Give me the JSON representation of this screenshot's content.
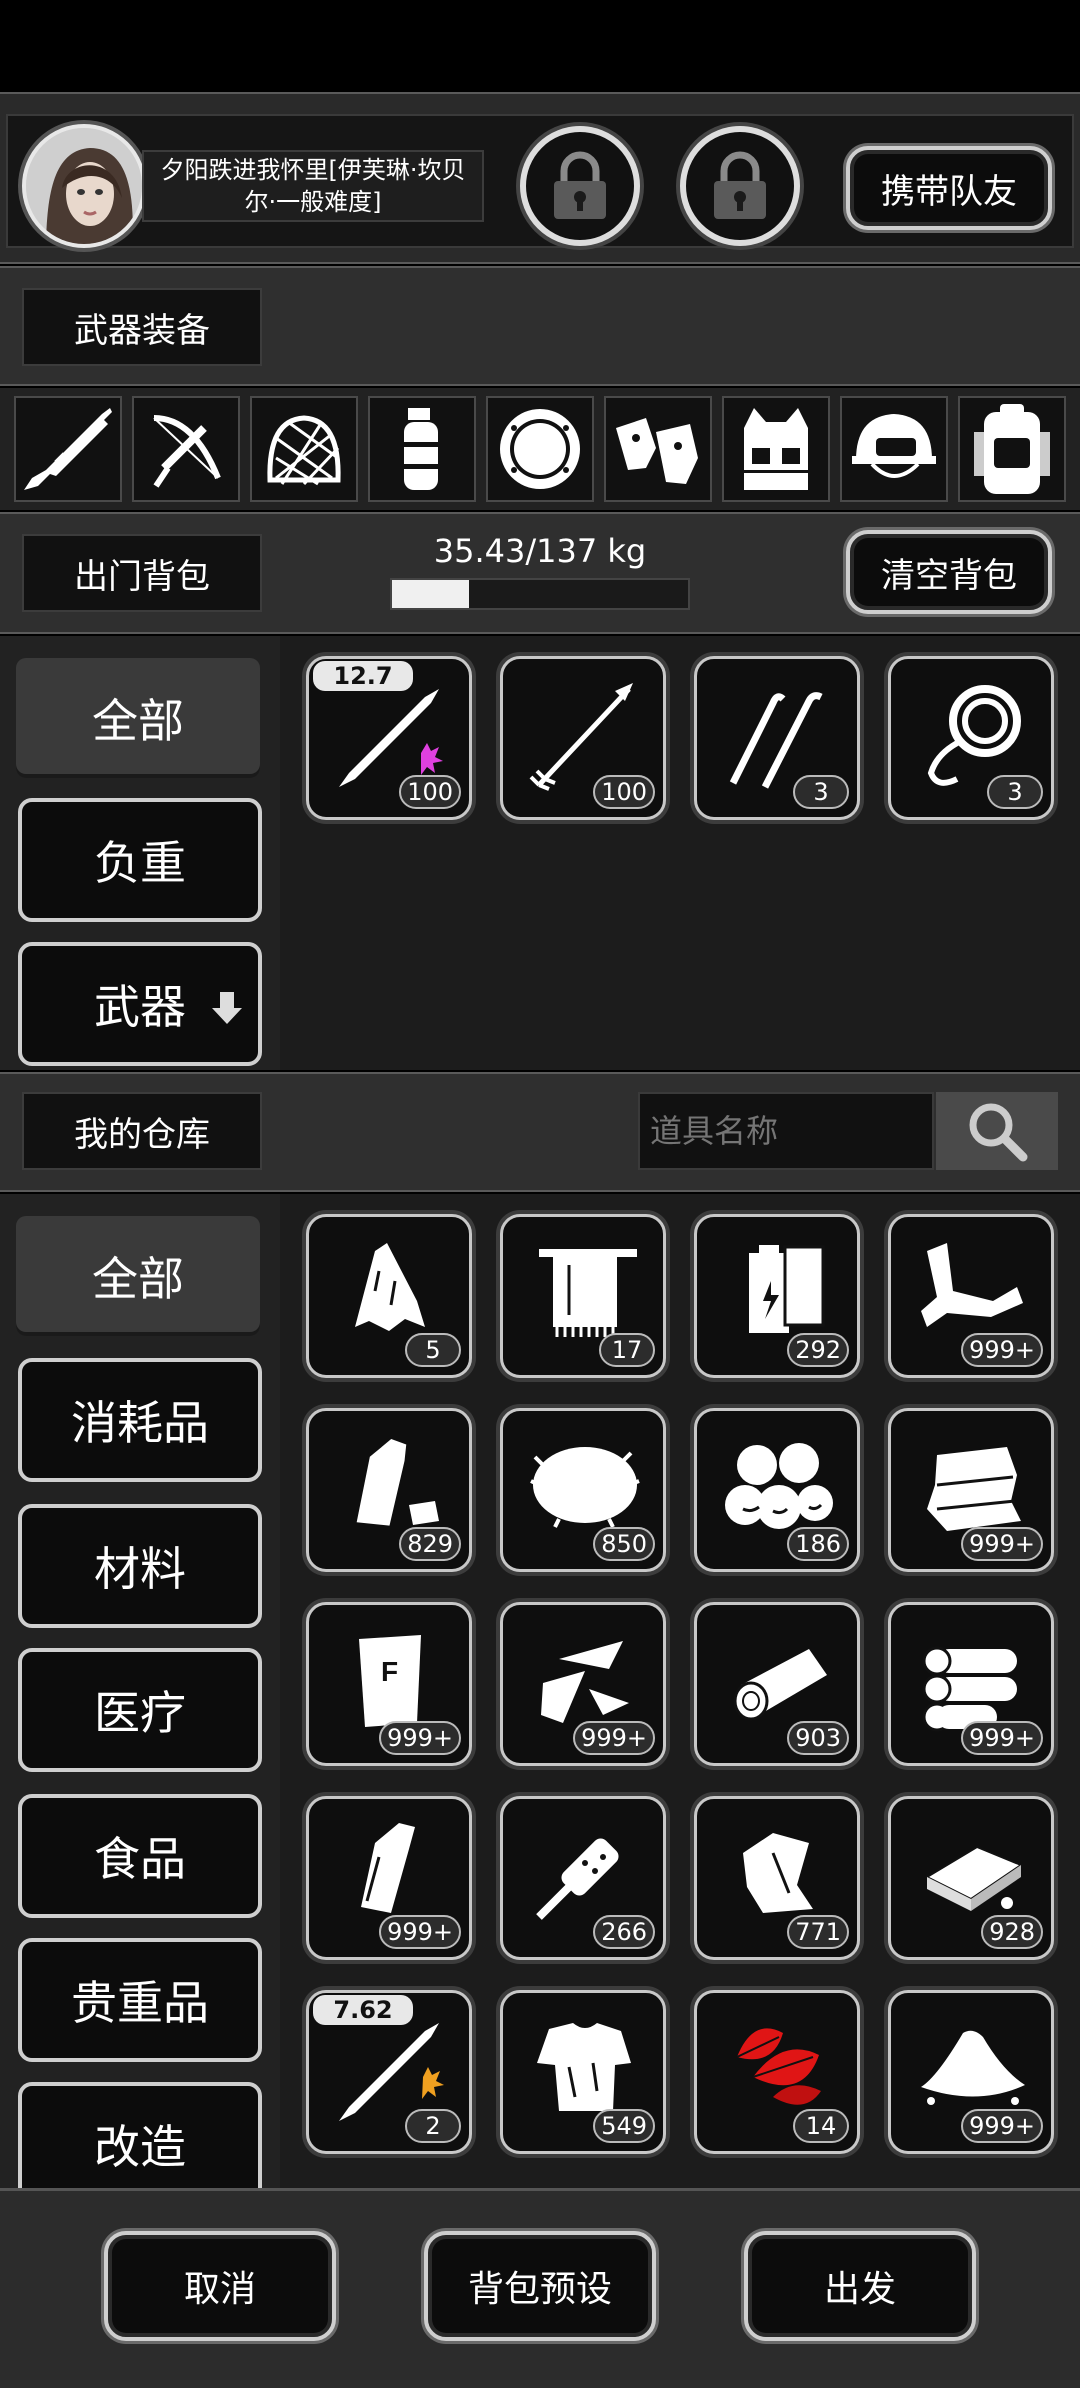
{
  "profile": {
    "name": "夕阳跌进我怀里[伊芙琳·坎贝尔·一般难度]",
    "carry_button": "携带队友"
  },
  "equipment": {
    "title": "武器装备",
    "slots": [
      "rifle-icon",
      "crossbow-icon",
      "helmet-net-icon",
      "grenade-icon",
      "shield-icon",
      "gloves-icon",
      "vest-icon",
      "helmet-icon",
      "backpack-icon"
    ]
  },
  "backpack": {
    "title": "出门背包",
    "weight": "35.43/137 kg",
    "weight_ratio": 0.2586,
    "clear_button": "清空背包",
    "categories": [
      "全部",
      "负重",
      "武器"
    ],
    "items": [
      {
        "icon": "bullet-icon",
        "caliber": "12.7",
        "count": "100"
      },
      {
        "icon": "arrow-icon",
        "count": "100"
      },
      {
        "icon": "lockpick-icon",
        "count": "3"
      },
      {
        "icon": "rope-icon",
        "count": "3"
      }
    ]
  },
  "warehouse": {
    "title": "我的仓库",
    "search_placeholder": "道具名称",
    "categories": [
      "全部",
      "消耗品",
      "材料",
      "医疗",
      "食品",
      "贵重品",
      "改造"
    ],
    "items": [
      {
        "icon": "cloth-scrap-icon",
        "count": "5"
      },
      {
        "icon": "towel-icon",
        "count": "17"
      },
      {
        "icon": "battery-icon",
        "count": "292"
      },
      {
        "icon": "pipe-icon",
        "count": "999+"
      },
      {
        "icon": "plastic-bottle-icon",
        "count": "829"
      },
      {
        "icon": "fur-icon",
        "count": "850"
      },
      {
        "icon": "stones-icon",
        "count": "186"
      },
      {
        "icon": "fabric-icon",
        "count": "999+"
      },
      {
        "icon": "flour-bag-icon",
        "count": "999+"
      },
      {
        "icon": "glass-shards-icon",
        "count": "999+"
      },
      {
        "icon": "log-icon",
        "count": "903"
      },
      {
        "icon": "logs-icon",
        "count": "999+"
      },
      {
        "icon": "glass-bottle-icon",
        "count": "999+"
      },
      {
        "icon": "pestle-icon",
        "count": "266"
      },
      {
        "icon": "scrap-metal-icon",
        "count": "771"
      },
      {
        "icon": "bread-icon",
        "count": "928"
      },
      {
        "icon": "bullet-icon",
        "caliber": "7.62",
        "count": "2"
      },
      {
        "icon": "rag-shirt-icon",
        "count": "549"
      },
      {
        "icon": "red-leaves-icon",
        "count": "14"
      },
      {
        "icon": "powder-pile-icon",
        "count": "999+"
      }
    ]
  },
  "footer": {
    "cancel": "取消",
    "preset": "背包预设",
    "go": "出发"
  },
  "colors": {
    "accent_red": "#e01515",
    "magenta": "#e040e0",
    "orange": "#f0a020"
  }
}
